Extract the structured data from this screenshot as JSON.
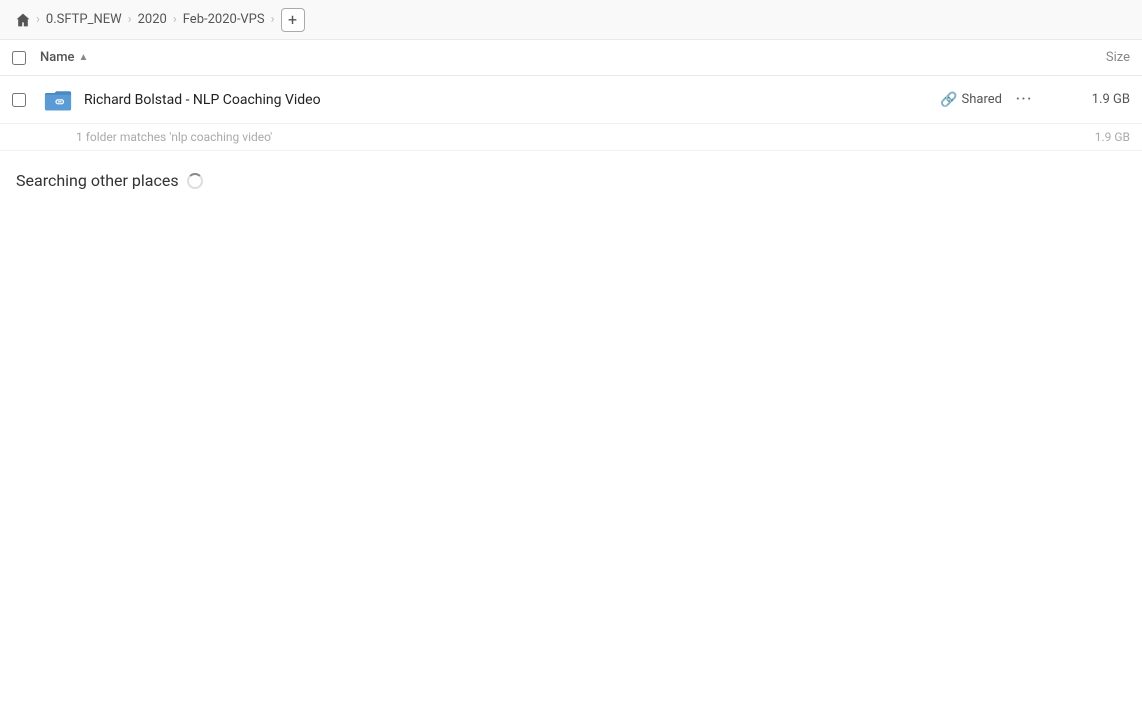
{
  "breadcrumb": {
    "home_icon": "🏠",
    "items": [
      "0.SFTP_NEW",
      "2020",
      "Feb-2020-VPS"
    ],
    "add_label": "+"
  },
  "columns": {
    "name_label": "Name",
    "sort_arrow": "▲",
    "size_label": "Size"
  },
  "file": {
    "name": "Richard Bolstad - NLP Coaching Video",
    "shared_label": "Shared",
    "more_label": "···",
    "size": "1.9 GB",
    "match_info": "1 folder matches 'nlp coaching video'",
    "match_size": "1.9 GB"
  },
  "search": {
    "searching_label": "Searching other places"
  }
}
